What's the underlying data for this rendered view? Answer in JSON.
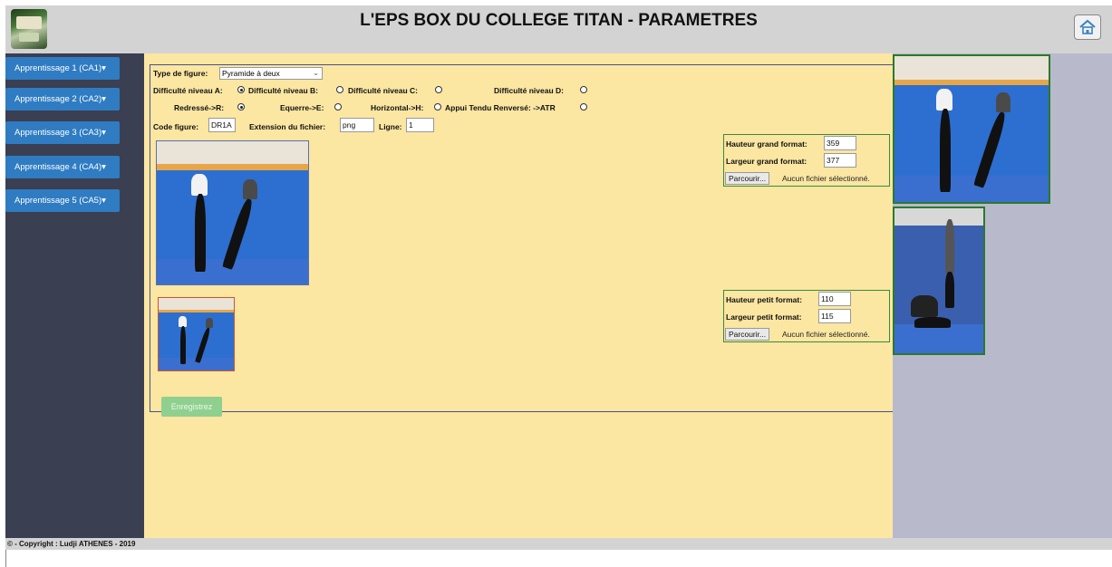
{
  "header": {
    "title": "L'EPS BOX DU COLLEGE TITAN - PARAMETRES",
    "logo_icon": "school-logo",
    "home_icon": "home-icon"
  },
  "sidebar": {
    "items": [
      {
        "label": "Apprentissage 1 (CA1)▾"
      },
      {
        "label": "Apprentissage 2 (CA2)▾"
      },
      {
        "label": "Apprentissage 3 (CA3)▾"
      },
      {
        "label": "Apprentissage 4 (CA4)▾"
      },
      {
        "label": "Apprentissage 5 (CA5)▾"
      }
    ]
  },
  "form": {
    "type_label": "Type de figure:",
    "type_value": "Pyramide à deux",
    "difficulty": {
      "a_label": "Difficulté niveau A:",
      "b_label": "Difficulté niveau B:",
      "c_label": "Difficulté niveau C:",
      "d_label": "Difficulté niveau D:",
      "selected": "A"
    },
    "position": {
      "r_label": "Redressé->R:",
      "e_label": "Equerre->E:",
      "h_label": "Horizontal->H:",
      "atr_label": "Appui Tendu Renversé: ->ATR",
      "selected": "R"
    },
    "code_label": "Code figure:",
    "code_value": "DR1A",
    "ext_label": "Extension du fichier:",
    "ext_value": "png",
    "ligne_label": "Ligne:",
    "ligne_value": "1",
    "save_label": "Enregistrez"
  },
  "grand_format": {
    "hauteur_label": "Hauteur grand format:",
    "hauteur_value": "359",
    "largeur_label": "Largeur grand format:",
    "largeur_value": "377",
    "browse_label": "Parcourir...",
    "nofile_label": "Aucun fichier sélectionné."
  },
  "petit_format": {
    "hauteur_label": "Hauteur petit format:",
    "hauteur_value": "110",
    "largeur_label": "Largeur petit format:",
    "largeur_value": "115",
    "browse_label": "Parcourir...",
    "nofile_label": "Aucun fichier sélectionné."
  },
  "footer": {
    "copyright": "© - Copyright : Ludji ATHENES - 2019"
  },
  "colors": {
    "main_bg": "#fbe6a2",
    "sidebar_bg": "#3a3f52",
    "button_blue": "#2f7cc2",
    "save_green": "#8fd08f"
  }
}
